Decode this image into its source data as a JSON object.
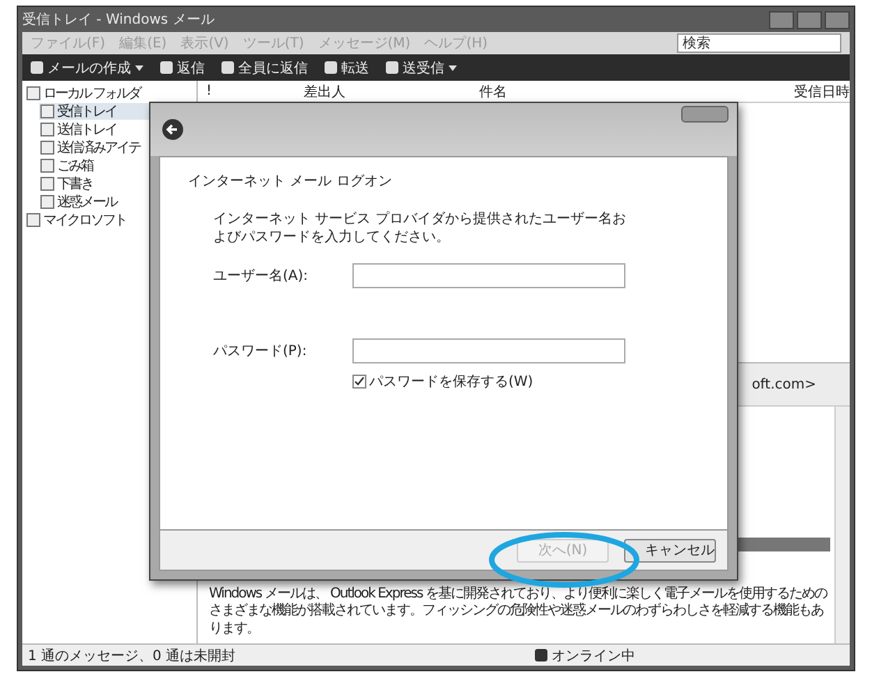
{
  "window": {
    "title": "受信トレイ - Windows メール"
  },
  "menu": [
    "ファイル(F)",
    "編集(E)",
    "表示(V)",
    "ツール(T)",
    "メッセージ(M)",
    "ヘルプ(H)"
  ],
  "search": {
    "placeholder": "検索"
  },
  "toolbar": [
    {
      "label": "メールの作成",
      "kind": "dropdown"
    },
    {
      "label": "返信",
      "kind": "plain"
    },
    {
      "label": "全員に返信",
      "kind": "plain"
    },
    {
      "label": "転送",
      "kind": "plain"
    },
    {
      "label": "送受信",
      "kind": "dropdown"
    }
  ],
  "folders": [
    {
      "label": "ローカル フォルダ",
      "selected": false,
      "children": [
        {
          "label": "受信トレイ",
          "selected": true
        },
        {
          "label": "送信トレイ",
          "selected": false
        },
        {
          "label": "送信済みアイテ",
          "selected": false
        },
        {
          "label": "ごみ箱",
          "selected": false
        },
        {
          "label": "下書き",
          "selected": false
        },
        {
          "label": "迷惑メール",
          "selected": false
        }
      ]
    },
    {
      "label": "マイクロソフト",
      "selected": false
    }
  ],
  "columns": [
    "!",
    "差出人",
    "件名",
    "受信日時"
  ],
  "preview": {
    "sender": "oft.com>",
    "body": "Windows メールは、 Outlook Express を基に開発されており、より便利に楽しく電子メールを使用するためのさまざまな機能が搭載されています。フィッシングの危険性や迷惑メールのわずらわしさを軽減する機能もあります。"
  },
  "status_bar": {
    "messages": "1 通のメッセージ、0 通は未開封",
    "connection": "オンライン中"
  },
  "dialog": {
    "heading": "インターネット メール ログオン",
    "instructions": "インターネット サービス プロバイダから提供されたユーザー名およびパスワードを入力してください。",
    "fields": [
      {
        "label": "ユーザー名(A):"
      },
      {
        "label": "パスワード(P):"
      }
    ],
    "remember": {
      "label": "パスワードを保存する(W)",
      "checked": true
    },
    "buttons": [
      {
        "label": "次へ(N)",
        "disabled": true
      },
      {
        "label": "キャンセル",
        "disabled": false
      }
    ]
  }
}
